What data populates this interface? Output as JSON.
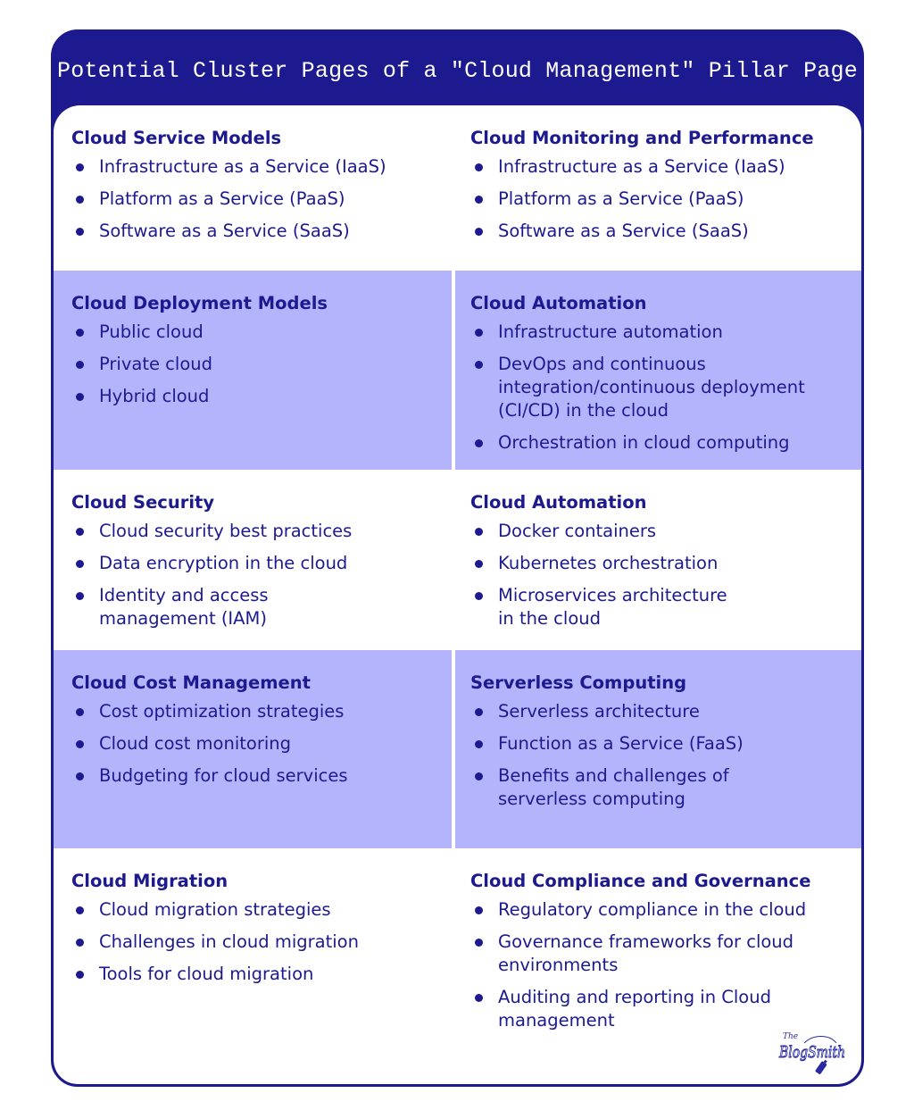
{
  "header": {
    "title": "Potential Cluster Pages of a \"Cloud Management\" Pillar Page"
  },
  "colors": {
    "navy": "#1c1a8e",
    "lavender": "#b4b4fc",
    "white": "#ffffff"
  },
  "rows": [
    {
      "tinted": false,
      "left": {
        "title": "Cloud Service Models",
        "items": [
          "Infrastructure as a Service (IaaS)",
          "Platform as a Service (PaaS)",
          "Software as a Service (SaaS)"
        ]
      },
      "right": {
        "title": "Cloud Monitoring and Performance",
        "items": [
          "Infrastructure as a Service (IaaS)",
          "Platform as a Service (PaaS)",
          "Software as a Service (SaaS)"
        ]
      }
    },
    {
      "tinted": true,
      "left": {
        "title": "Cloud Deployment Models",
        "items": [
          "Public cloud",
          "Private cloud",
          "Hybrid cloud"
        ]
      },
      "right": {
        "title": "Cloud Automation",
        "items": [
          "Infrastructure automation",
          "DevOps and continuous integration/continuous deployment (CI/CD) in the cloud",
          "Orchestration in cloud computing"
        ]
      }
    },
    {
      "tinted": false,
      "left": {
        "title": "Cloud Security",
        "items": [
          "Cloud security best practices",
          "Data encryption in the cloud",
          "Identity and access management (IAM)"
        ]
      },
      "right": {
        "title": "Cloud Automation",
        "items": [
          "Docker containers",
          "Kubernetes orchestration",
          "Microservices architecture in the cloud"
        ]
      }
    },
    {
      "tinted": true,
      "left": {
        "title": "Cloud Cost Management",
        "items": [
          "Cost optimization strategies",
          "Cloud cost monitoring",
          "Budgeting for cloud services"
        ]
      },
      "right": {
        "title": "Serverless Computing",
        "items": [
          "Serverless architecture",
          "Function as a Service (FaaS)",
          "Benefits and challenges of serverless computing"
        ]
      }
    },
    {
      "tinted": false,
      "left": {
        "title": "Cloud Migration",
        "items": [
          "Cloud migration strategies",
          "Challenges in cloud migration",
          "Tools for cloud migration"
        ]
      },
      "right": {
        "title": "Cloud Compliance and Governance",
        "items": [
          "Regulatory compliance in the cloud",
          "Governance frameworks for cloud environments",
          "Auditing and reporting in Cloud management"
        ]
      }
    }
  ],
  "logo": {
    "name": "The BlogSmith",
    "small_text": "The",
    "main_text": "BlogSmith"
  }
}
